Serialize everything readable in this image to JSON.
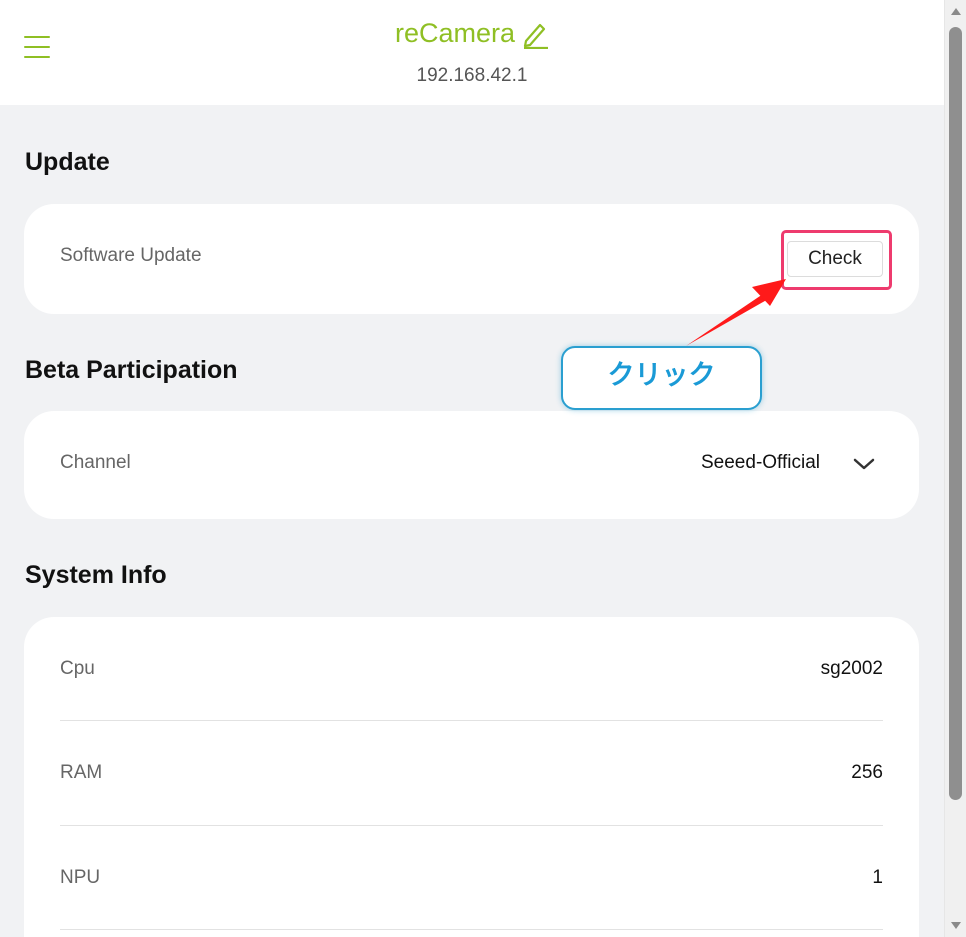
{
  "header": {
    "app_title": "reCamera",
    "ip_address": "192.168.42.1"
  },
  "update": {
    "section_title": "Update",
    "software_update_label": "Software Update",
    "check_button_label": "Check"
  },
  "annotation": {
    "callout_text": "クリック",
    "highlight_color": "#ee3b6e",
    "arrow_color": "#ff1a1a",
    "callout_border_color": "#2a9fd0"
  },
  "beta": {
    "section_title": "Beta Participation",
    "channel_label": "Channel",
    "channel_value": "Seeed-Official"
  },
  "system_info": {
    "section_title": "System Info",
    "rows": [
      {
        "label": "Cpu",
        "value": "sg2002"
      },
      {
        "label": "RAM",
        "value": "256"
      },
      {
        "label": "NPU",
        "value": "1"
      }
    ]
  },
  "theme": {
    "accent": "#8fbf24",
    "background": "#f1f2f4",
    "card": "#ffffff"
  },
  "icons": {
    "menu": "hamburger-menu-icon",
    "edit": "pencil-edit-icon",
    "dropdown": "chevron-down-icon"
  }
}
